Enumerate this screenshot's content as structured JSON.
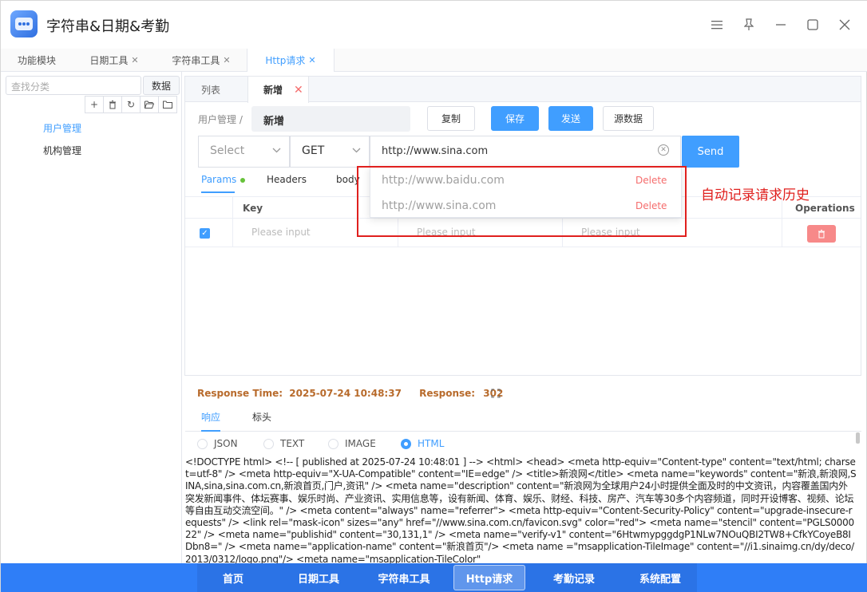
{
  "window": {
    "title": "字符串&日期&考勤"
  },
  "top_tabs": [
    {
      "label": "功能模块",
      "closable": false
    },
    {
      "label": "日期工具",
      "closable": true
    },
    {
      "label": "字符串工具",
      "closable": true
    },
    {
      "label": "Http请求",
      "closable": true,
      "active": true
    }
  ],
  "sidebar": {
    "search_placeholder": "查找分类",
    "data_button": "数据",
    "tree": [
      {
        "label": "用户管理",
        "active": true
      },
      {
        "label": "机构管理",
        "active": false
      }
    ]
  },
  "sub_tabs": [
    {
      "label": "列表"
    },
    {
      "label": "新增",
      "active": true
    }
  ],
  "request": {
    "breadcrumb": "用户管理 /",
    "name": "新增",
    "buttons": {
      "copy": "复制",
      "save": "保存",
      "send_cn": "发送",
      "source": "源数据"
    },
    "select_placeholder": "Select",
    "method": "GET",
    "url": "http://www.sina.com",
    "send": "Send"
  },
  "param_tabs": [
    {
      "label": "Params",
      "active": true,
      "dot": true
    },
    {
      "label": "Headers"
    },
    {
      "label": "body"
    }
  ],
  "table": {
    "columns": [
      "Key",
      "Operations"
    ],
    "row_placeholders": [
      "Please input",
      "Please input",
      "Please input"
    ]
  },
  "history_dropdown": [
    {
      "url": "http://www.baidu.com",
      "action": "Delete"
    },
    {
      "url": "http://www.sina.com",
      "action": "Delete"
    }
  ],
  "annotation": "自动记录请求历史",
  "response": {
    "time_label": "Response Time:",
    "time_value": "2025-07-24 10:48:37",
    "code_label": "Response:",
    "code_value": "302",
    "tabs": [
      {
        "label": "响应",
        "active": true
      },
      {
        "label": "标头"
      }
    ],
    "formats": [
      {
        "label": "JSON"
      },
      {
        "label": "TEXT"
      },
      {
        "label": "IMAGE"
      },
      {
        "label": "HTML",
        "checked": true
      }
    ],
    "body": "<!DOCTYPE html> <!-- [ published at 2025-07-24 10:48:01 ] --> <html> <head> <meta http-equiv=\"Content-type\" content=\"text/html; charset=utf-8\" /> <meta http-equiv=\"X-UA-Compatible\" content=\"IE=edge\" /> <title>新浪网</title> <meta name=\"keywords\" content=\"新浪,新浪网,SINA,sina,sina.com.cn,新浪首页,门户,资讯\" /> <meta name=\"description\" content=\"新浪网为全球用户24小时提供全面及时的中文资讯，内容覆盖国内外突发新闻事件、体坛赛事、娱乐时尚、产业资讯、实用信息等，设有新闻、体育、娱乐、财经、科技、房产、汽车等30多个内容频道，同时开设博客、视频、论坛等自由互动交流空间。\" /> <meta content=\"always\" name=\"referrer\"> <meta http-equiv=\"Content-Security-Policy\" content=\"upgrade-insecure-requests\" /> <link rel=\"mask-icon\" sizes=\"any\" href=\"//www.sina.com.cn/favicon.svg\" color=\"red\"> <meta name=\"stencil\" content=\"PGLS000022\" /> <meta name=\"publishid\" content=\"30,131,1\" /> <meta name=\"verify-v1\" content=\"6HtwmypggdgP1NLw7NOuQBI2TW8+CfkYCoyeB8IDbn8=\" /> <meta name=\"application-name\" content=\"新浪首页\"/> <meta name =\"msapplication-TileImage\" content=\"//i1.sinaimg.cn/dy/deco/2013/0312/logo.png\"/> <meta name=\"msapplication-TileColor\""
  },
  "bottom_nav": [
    {
      "label": "首页"
    },
    {
      "label": "日期工具"
    },
    {
      "label": "字符串工具"
    },
    {
      "label": "Http请求",
      "active": true
    },
    {
      "label": "考勤记录"
    },
    {
      "label": "系统配置"
    }
  ],
  "colors": {
    "accent": "#409eff",
    "danger": "#f56c6c",
    "annotation": "#e0201e",
    "bottom_bar": "#2f7ef7",
    "response_meta": "#b86b2c"
  }
}
